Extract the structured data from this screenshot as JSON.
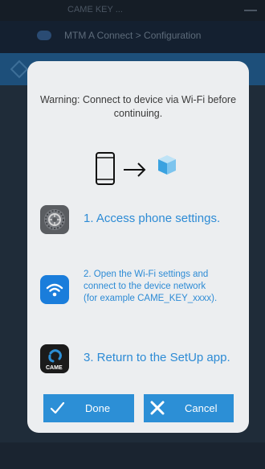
{
  "background": {
    "status_text": "CAME KEY ...",
    "header_title": "MTM A Connect > Configuration"
  },
  "dialog": {
    "warning": "Warning: Connect to device via Wi-Fi before continuing.",
    "diagram_icons": [
      "phone-icon",
      "arrow-right-icon",
      "device-cube-icon"
    ],
    "steps": [
      {
        "icon": "settings-gear-icon",
        "text": "1. Access phone settings."
      },
      {
        "icon": "wifi-icon",
        "text_lines": [
          "2. Open the Wi-Fi settings and",
          "connect to the device network",
          "(for example CAME_KEY_xxxx)."
        ]
      },
      {
        "icon": "came-app-icon",
        "icon_label": "CAME",
        "text": "3. Return to the SetUp app."
      }
    ],
    "buttons": {
      "done_label": "Done",
      "cancel_label": "Cancel"
    }
  },
  "colors": {
    "accent": "#2c8fd6",
    "dialog_bg": "#eceef0",
    "step_text": "#2d8bd5",
    "overlay_bg": "#1f2c39"
  }
}
